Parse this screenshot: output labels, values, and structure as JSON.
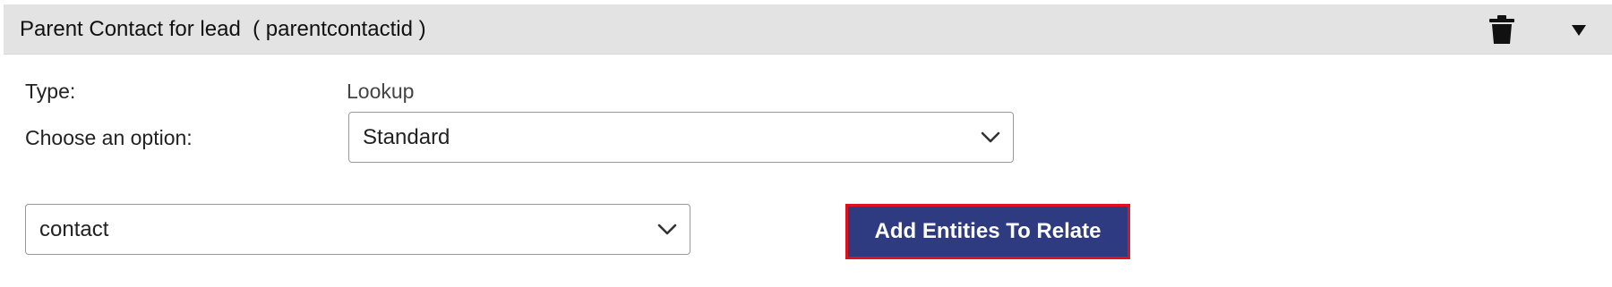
{
  "header": {
    "title": "Parent Contact for lead  ( parentcontactid )",
    "delete_icon": "trash-icon",
    "collapse_icon": "caret-down-icon",
    "background": "#e3e3e3"
  },
  "fields": {
    "type_label": "Type:",
    "type_value": "Lookup",
    "option_label": "Choose an option:",
    "option_selected": "Standard"
  },
  "entity_select": {
    "selected": "contact"
  },
  "add_button": {
    "label": "Add Entities To Relate",
    "background": "#2e3b80",
    "border_color": "#e0101e"
  }
}
